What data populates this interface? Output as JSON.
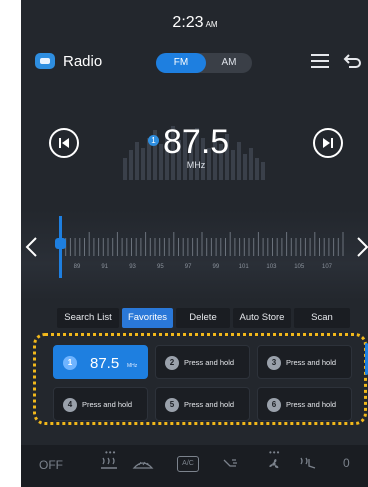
{
  "status": {
    "time": "2:23",
    "ampm": "AM"
  },
  "header": {
    "title": "Radio",
    "band_fm": "FM",
    "band_am": "AM",
    "icons": [
      "radio-icon",
      "menu-icon",
      "back-icon"
    ]
  },
  "tuner": {
    "frequency": "87.5",
    "unit": "MHz",
    "favorite_index": "1",
    "scale_labels": [
      "89",
      "91",
      "93",
      "95",
      "97",
      "99",
      "101",
      "103",
      "105",
      "107"
    ]
  },
  "tabs": [
    "Search List",
    "Favorites",
    "Delete",
    "Auto Store",
    "Scan"
  ],
  "active_tab": "Favorites",
  "presets": [
    {
      "num": "1",
      "freq": "87.5",
      "unit": "MHz"
    },
    {
      "num": "2",
      "label": "Press and hold"
    },
    {
      "num": "3",
      "label": "Press and hold"
    },
    {
      "num": "4",
      "label": "Press and hold"
    },
    {
      "num": "5",
      "label": "Press and hold"
    },
    {
      "num": "6",
      "label": "Press and hold"
    }
  ],
  "climate": {
    "left_label": "OFF",
    "right_label": "0",
    "icons": [
      "heated-seat-icon",
      "windshield-defrost-icon",
      "ac-icon",
      "seat-airflow-icon",
      "fan-icon",
      "rear-heated-seat-icon"
    ],
    "ac_text": "A/C"
  },
  "colors": {
    "accent": "#1e7fe0",
    "highlight": "#f2b81b",
    "background": "#23272d"
  }
}
